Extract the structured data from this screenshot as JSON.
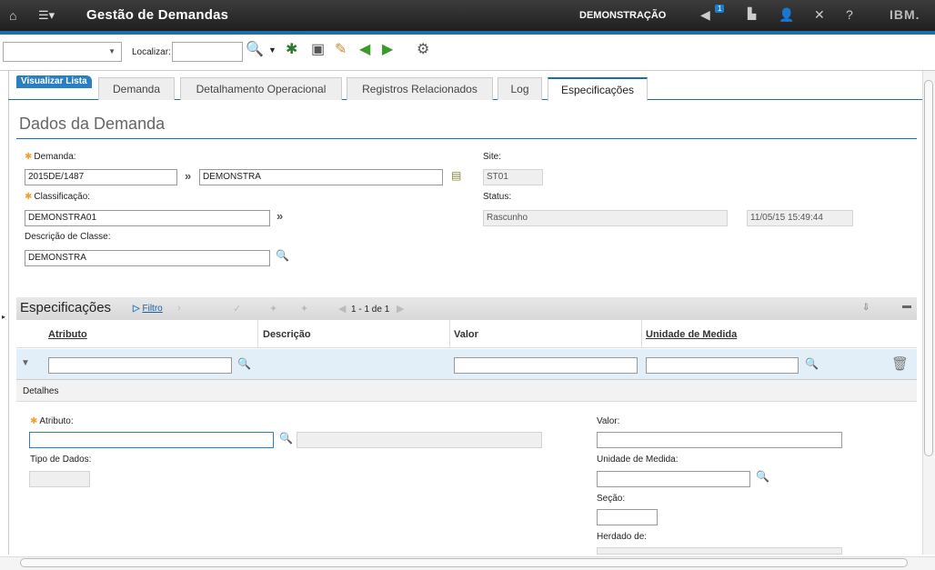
{
  "titlebar": {
    "title": "Gestão de Demandas",
    "context": "DEMONSTRAÇÃO",
    "badge_count": "1",
    "brand": "IBM."
  },
  "toolbar": {
    "search_label": "Localizar:"
  },
  "tabs": [
    {
      "label": "Visualizar Lista"
    },
    {
      "label": "Demanda"
    },
    {
      "label": "Detalhamento Operacional"
    },
    {
      "label": "Registros Relacionados"
    },
    {
      "label": "Log"
    },
    {
      "label": "Especificações"
    }
  ],
  "section": {
    "title": "Dados da Demanda"
  },
  "form": {
    "demanda_label": "Demanda:",
    "demanda_value": "2015DE/1487",
    "demanda_desc": "DEMONSTRA",
    "classificacao_label": "Classificação:",
    "classificacao_value": "DEMONSTRA01",
    "descricao_classe_label": "Descrição de Classe:",
    "descricao_classe_value": "DEMONSTRA",
    "site_label": "Site:",
    "site_value": "ST01",
    "status_label": "Status:",
    "status_value": "Rascunho",
    "status_date": "11/05/15 15:49:44"
  },
  "table": {
    "title": "Especificações",
    "filter_label": "Filtro",
    "paging": "1 - 1 de 1",
    "columns": [
      "Atributo",
      "Descrição",
      "Valor",
      "Unidade de Medida"
    ]
  },
  "details": {
    "title": "Detalhes",
    "atributo_label": "Atributo:",
    "tipo_dados_label": "Tipo de Dados:",
    "valor_label": "Valor:",
    "unidade_label": "Unidade de Medida:",
    "secao_label": "Seção:",
    "herdado_label": "Herdado de:"
  },
  "icons": {
    "home": "home-icon",
    "menu": "menu-icon",
    "search": "magnifier-icon",
    "delete": "trash-icon",
    "chevron": "double-chevron-icon"
  }
}
